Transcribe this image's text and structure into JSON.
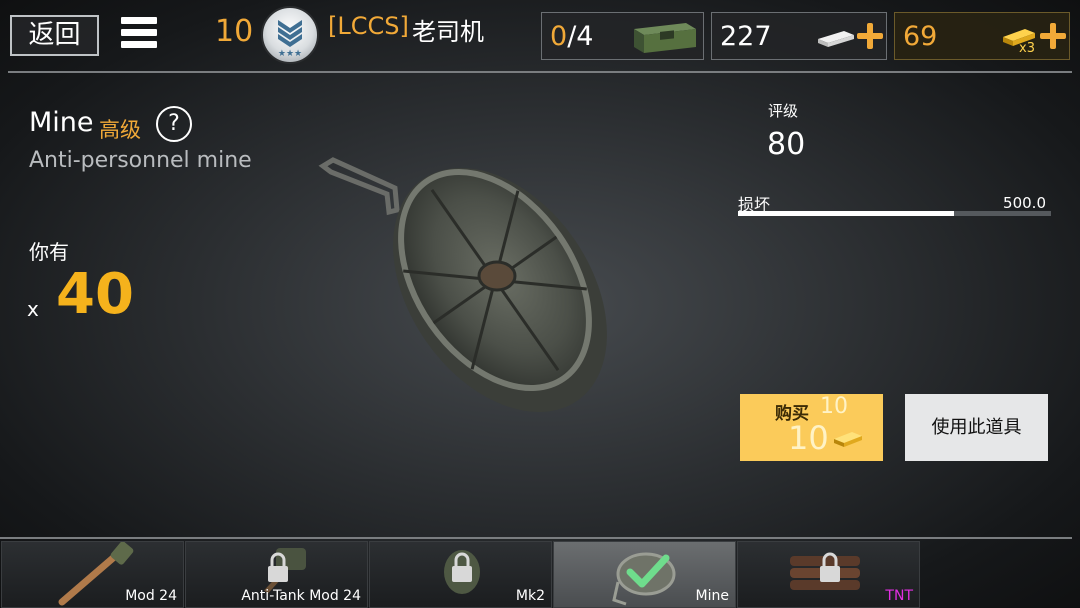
{
  "header": {
    "back_label": "返回",
    "level": "10",
    "player_tag": "[LCCS]",
    "player_name": "老司机",
    "crates": {
      "current": "0",
      "max": "/4"
    },
    "silver": "227",
    "gold": "69",
    "gold_multiplier": "x3"
  },
  "item": {
    "name": "Mine",
    "grade": "高级",
    "help": "?",
    "description": "Anti-personnel mine",
    "owned_label": "你有",
    "owned_x": "x",
    "owned_count": "40"
  },
  "stats": {
    "rating_label": "评级",
    "rating_value": "80",
    "damage_label": "损坏",
    "damage_value": "500.0",
    "damage_fill_fraction": 0.69
  },
  "actions": {
    "buy_label": "购买",
    "buy_qty": "10",
    "buy_price": "10",
    "use_label": "使用此道具"
  },
  "slots": [
    {
      "label": "Mod 24",
      "locked": false,
      "active": false,
      "magenta": false
    },
    {
      "label": "Anti-Tank Mod 24",
      "locked": true,
      "active": false,
      "magenta": false
    },
    {
      "label": "Mk2",
      "locked": true,
      "active": false,
      "magenta": false
    },
    {
      "label": "Mine",
      "locked": false,
      "active": true,
      "magenta": false
    },
    {
      "label": "TNT",
      "locked": true,
      "active": false,
      "magenta": true
    }
  ],
  "colors": {
    "accent": "#f1a938",
    "gold_button": "#fbcb5a",
    "magenta": "#e22fe2"
  }
}
